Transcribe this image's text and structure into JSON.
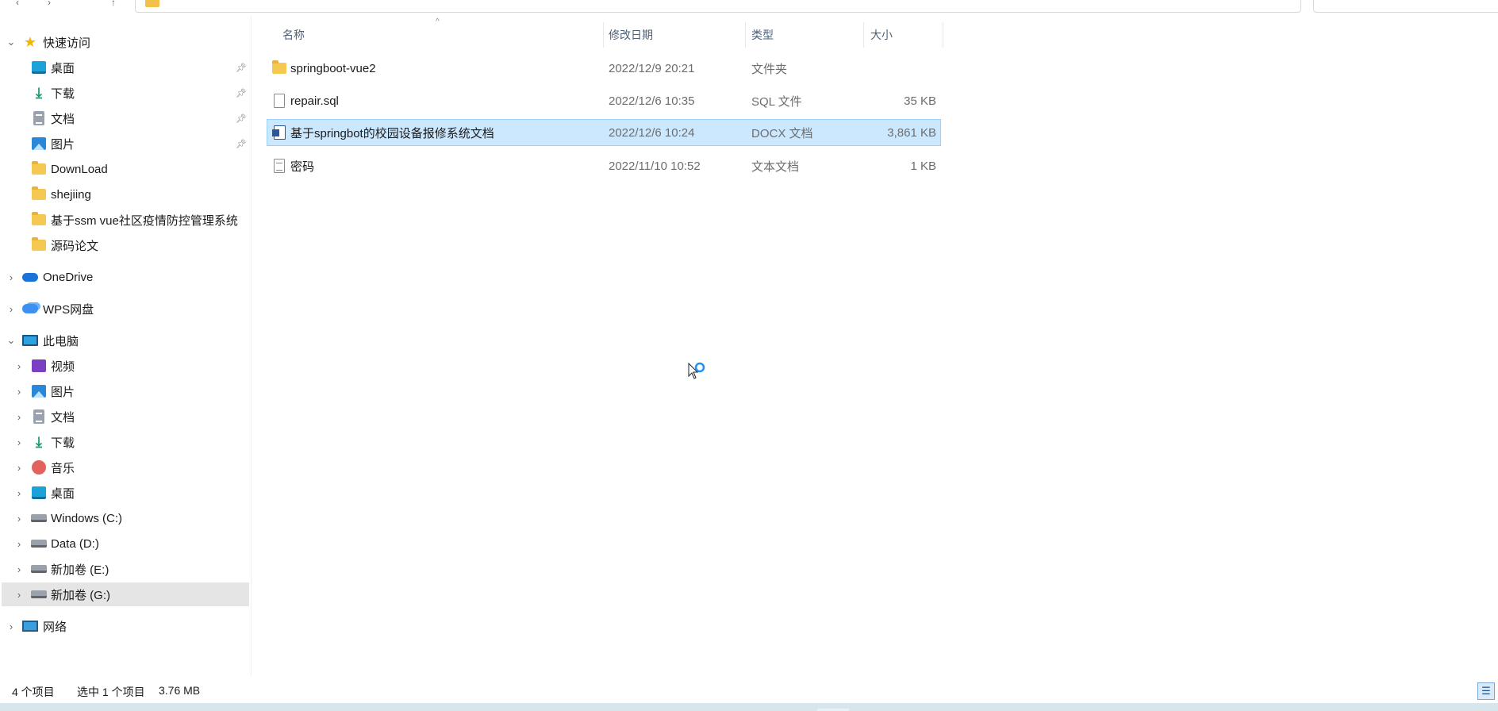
{
  "sidebar": {
    "quick_access": {
      "label": "快速访问",
      "items": [
        {
          "label": "桌面",
          "icon": "desktop-icon"
        },
        {
          "label": "下载",
          "icon": "download-icon"
        },
        {
          "label": "文档",
          "icon": "document-icon"
        },
        {
          "label": "图片",
          "icon": "pictures-icon"
        },
        {
          "label": "DownLoad",
          "icon": "folder-icon"
        },
        {
          "label": "shejiing",
          "icon": "folder-icon"
        },
        {
          "label": "基于ssm vue社区疫情防控管理系统",
          "icon": "folder-icon"
        },
        {
          "label": "源码论文",
          "icon": "folder-icon"
        }
      ]
    },
    "onedrive": {
      "label": "OneDrive"
    },
    "wps": {
      "label": "WPS网盘"
    },
    "this_pc": {
      "label": "此电脑",
      "items": [
        {
          "label": "视频",
          "icon": "video-icon"
        },
        {
          "label": "图片",
          "icon": "pictures-icon"
        },
        {
          "label": "文档",
          "icon": "document-icon"
        },
        {
          "label": "下载",
          "icon": "download-icon"
        },
        {
          "label": "音乐",
          "icon": "music-icon"
        },
        {
          "label": "桌面",
          "icon": "desktop-icon"
        },
        {
          "label": "Windows (C:)",
          "icon": "windows-drive-icon"
        },
        {
          "label": "Data (D:)",
          "icon": "drive-icon"
        },
        {
          "label": "新加卷 (E:)",
          "icon": "drive-icon"
        },
        {
          "label": "新加卷 (G:)",
          "icon": "drive-icon"
        }
      ]
    },
    "network": {
      "label": "网络"
    }
  },
  "columns": {
    "name": "名称",
    "date": "修改日期",
    "type": "类型",
    "size": "大小"
  },
  "files": [
    {
      "name": "springboot-vue2",
      "date": "2022/12/9 20:21",
      "type": "文件夹",
      "size": "",
      "icon": "folder-icon"
    },
    {
      "name": "repair.sql",
      "date": "2022/12/6 10:35",
      "type": "SQL 文件",
      "size": "35 KB",
      "icon": "sql-file-icon"
    },
    {
      "name": "基于springbot的校园设备报修系统文档",
      "date": "2022/12/6 10:24",
      "type": "DOCX 文档",
      "size": "3,861 KB",
      "icon": "word-doc-icon"
    },
    {
      "name": "密码",
      "date": "2022/11/10 10:52",
      "type": "文本文档",
      "size": "1 KB",
      "icon": "text-file-icon"
    }
  ],
  "status": {
    "count": "4 个项目",
    "selection": "选中 1 个项目",
    "selected_size": "3.76 MB"
  }
}
